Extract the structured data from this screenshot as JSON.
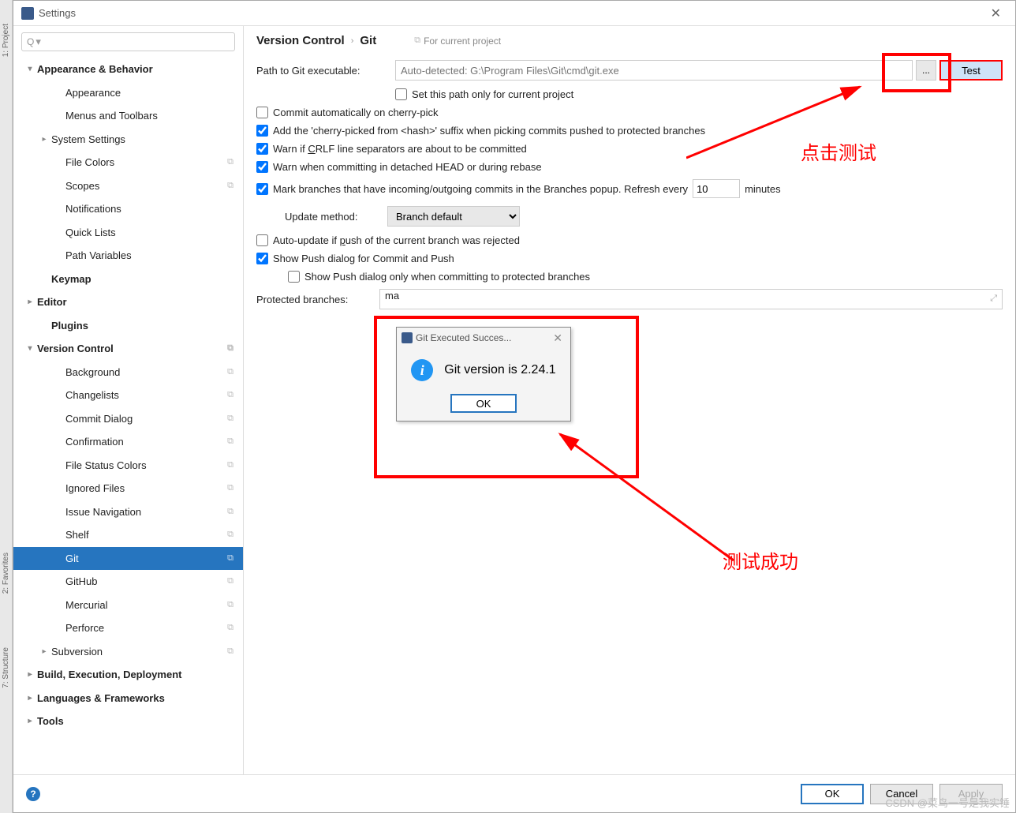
{
  "window": {
    "title": "Settings"
  },
  "leftRail": {
    "project": "1: Project",
    "favorites": "2: Favorites",
    "structure": "7: Structure"
  },
  "search": {
    "placeholder": "Q▾"
  },
  "sidebar": {
    "items": [
      {
        "label": "Appearance & Behavior",
        "bold": true,
        "chev": "v",
        "ind": 0
      },
      {
        "label": "Appearance",
        "ind": 2
      },
      {
        "label": "Menus and Toolbars",
        "ind": 2
      },
      {
        "label": "System Settings",
        "chev": ">",
        "ind": 1
      },
      {
        "label": "File Colors",
        "ind": 2,
        "badge": true
      },
      {
        "label": "Scopes",
        "ind": 2,
        "badge": true
      },
      {
        "label": "Notifications",
        "ind": 2
      },
      {
        "label": "Quick Lists",
        "ind": 2
      },
      {
        "label": "Path Variables",
        "ind": 2
      },
      {
        "label": "Keymap",
        "bold": true,
        "ind": 1
      },
      {
        "label": "Editor",
        "bold": true,
        "chev": ">",
        "ind": 0
      },
      {
        "label": "Plugins",
        "bold": true,
        "ind": 1
      },
      {
        "label": "Version Control",
        "bold": true,
        "chev": "v",
        "ind": 0,
        "badge": true
      },
      {
        "label": "Background",
        "ind": 2,
        "badge": true
      },
      {
        "label": "Changelists",
        "ind": 2,
        "badge": true
      },
      {
        "label": "Commit Dialog",
        "ind": 2,
        "badge": true
      },
      {
        "label": "Confirmation",
        "ind": 2,
        "badge": true
      },
      {
        "label": "File Status Colors",
        "ind": 2,
        "badge": true
      },
      {
        "label": "Ignored Files",
        "ind": 2,
        "badge": true
      },
      {
        "label": "Issue Navigation",
        "ind": 2,
        "badge": true
      },
      {
        "label": "Shelf",
        "ind": 2,
        "badge": true
      },
      {
        "label": "Git",
        "ind": 2,
        "badge": true,
        "selected": true
      },
      {
        "label": "GitHub",
        "ind": 2,
        "badge": true
      },
      {
        "label": "Mercurial",
        "ind": 2,
        "badge": true
      },
      {
        "label": "Perforce",
        "ind": 2,
        "badge": true
      },
      {
        "label": "Subversion",
        "chev": ">",
        "ind": 1,
        "badge": true
      },
      {
        "label": "Build, Execution, Deployment",
        "bold": true,
        "chev": ">",
        "ind": 0
      },
      {
        "label": "Languages & Frameworks",
        "bold": true,
        "chev": ">",
        "ind": 0
      },
      {
        "label": "Tools",
        "bold": true,
        "chev": ">",
        "ind": 0
      }
    ]
  },
  "breadcrumb": {
    "a": "Version Control",
    "b": "Git",
    "forProject": "For current project"
  },
  "git": {
    "pathLabel": "Path to Git executable:",
    "pathValue": "Auto-detected: G:\\Program Files\\Git\\cmd\\git.exe",
    "testLabel": "Test",
    "setPathOnly": "Set this path only for current project",
    "commitAuto": "Commit automatically on cherry-pick",
    "addSuffix": "Add the 'cherry-picked from <hash>' suffix when picking commits pushed to protected branches",
    "warnCrlf_a": "Warn if ",
    "warnCrlf_u": "C",
    "warnCrlf_b": "RLF line separators are about to be committed",
    "warnDetached": "Warn when committing in detached HEAD or during rebase",
    "markBranches": "Mark branches that have incoming/outgoing commits in the Branches popup.  Refresh every",
    "refreshVal": "10",
    "minutes": "minutes",
    "updateMethod": "Update method:",
    "updateVal": "Branch default",
    "autoUpdate_a": "Auto-update if ",
    "autoUpdate_u": "p",
    "autoUpdate_b": "ush of the current branch was rejected",
    "showPush": "Show Push dialog for Commit and Push",
    "showPushOnly": "Show Push dialog only when committing to protected branches",
    "protectedLabel": "Protected branches:",
    "protectedVal": "ma"
  },
  "modal": {
    "title": "Git Executed Succes...",
    "message": "Git version is 2.24.1",
    "ok": "OK"
  },
  "footer": {
    "ok": "OK",
    "cancel": "Cancel",
    "apply": "Apply"
  },
  "annotations": {
    "a1": "点击测试",
    "a2": "测试成功"
  },
  "watermark": "CSDN @菜鸟一号是我实锤"
}
